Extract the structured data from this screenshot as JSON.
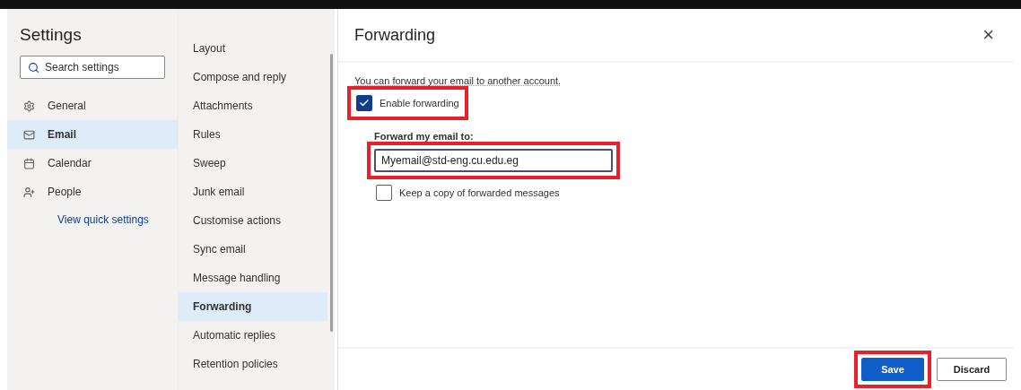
{
  "settings": {
    "title": "Settings",
    "search": {
      "placeholder": "Search settings"
    },
    "categories": [
      {
        "label": "General",
        "selected": false
      },
      {
        "label": "Email",
        "selected": true
      },
      {
        "label": "Calendar",
        "selected": false
      },
      {
        "label": "People",
        "selected": false
      }
    ],
    "quick_link": "View quick settings"
  },
  "subnav": [
    {
      "label": "Layout",
      "selected": false
    },
    {
      "label": "Compose and reply",
      "selected": false
    },
    {
      "label": "Attachments",
      "selected": false
    },
    {
      "label": "Rules",
      "selected": false
    },
    {
      "label": "Sweep",
      "selected": false
    },
    {
      "label": "Junk email",
      "selected": false
    },
    {
      "label": "Customise actions",
      "selected": false
    },
    {
      "label": "Sync email",
      "selected": false
    },
    {
      "label": "Message handling",
      "selected": false
    },
    {
      "label": "Forwarding",
      "selected": true
    },
    {
      "label": "Automatic replies",
      "selected": false
    },
    {
      "label": "Retention policies",
      "selected": false
    }
  ],
  "pane": {
    "title": "Forwarding",
    "close": "×",
    "intro": "You can forward your email to another account.",
    "enable": {
      "label": "Enable forwarding",
      "checked": true,
      "highlighted": true
    },
    "forward_to": {
      "label": "Forward my email to:",
      "value": "Myemail@std-eng.cu.edu.eg",
      "highlighted": true
    },
    "keep_copy": {
      "label": "Keep a copy of forwarded messages",
      "checked": false,
      "highlighted": false
    },
    "buttons": [
      {
        "label": "Save",
        "kind": "primary",
        "highlighted": true
      },
      {
        "label": "Discard",
        "kind": "secondary",
        "highlighted": false
      }
    ]
  }
}
